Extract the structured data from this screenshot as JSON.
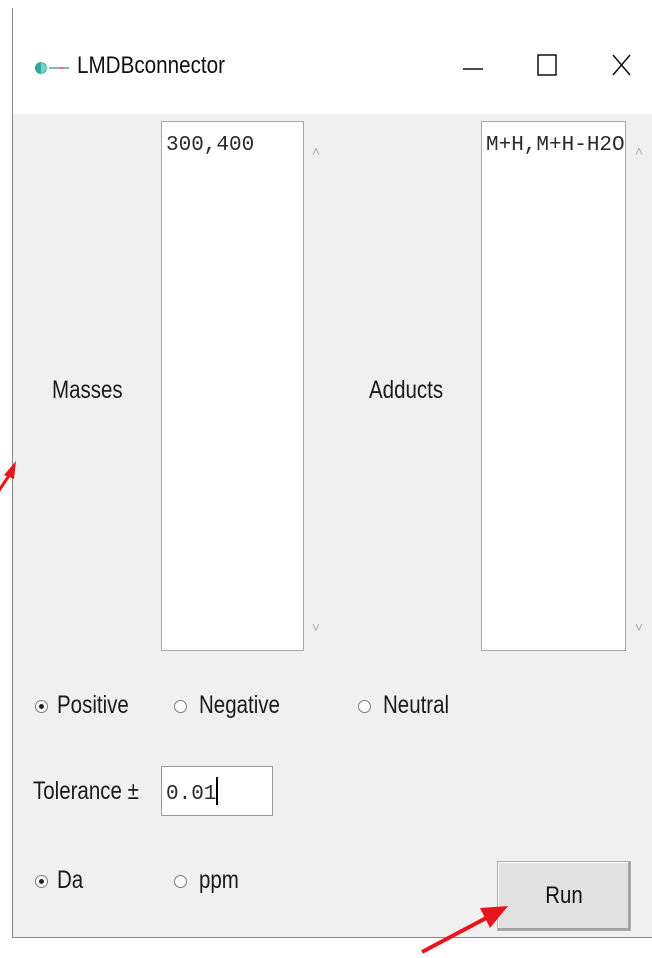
{
  "window": {
    "title": "LMDBconnector",
    "controls": [
      "minimize-icon",
      "maximize-icon",
      "close-icon"
    ]
  },
  "form": {
    "masses_label": "Masses",
    "masses_value": "300,400",
    "adducts_label": "Adducts",
    "adducts_value": "M+H,M+H-H2O",
    "ion_mode": {
      "options": [
        "Positive",
        "Negative",
        "Neutral"
      ],
      "selected": "Positive"
    },
    "tolerance_label": "Tolerance ±",
    "tolerance_value": "0.01",
    "unit": {
      "options": [
        "Da",
        "ppm"
      ],
      "selected": "Da"
    },
    "run_label": "Run"
  },
  "annotations": {
    "arrow_color": "#e8141c"
  }
}
